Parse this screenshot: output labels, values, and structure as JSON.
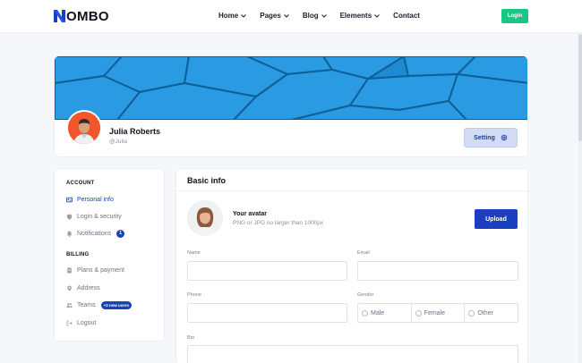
{
  "brand": {
    "name": "OMBO",
    "mark": "N-mark-logo"
  },
  "nav": {
    "items": [
      {
        "label": "Home",
        "has_dropdown": true
      },
      {
        "label": "Pages",
        "has_dropdown": true
      },
      {
        "label": "Blog",
        "has_dropdown": true
      },
      {
        "label": "Elements",
        "has_dropdown": true
      },
      {
        "label": "Contact",
        "has_dropdown": false
      }
    ],
    "login_label": "Login"
  },
  "profile": {
    "name": "Julia Roberts",
    "handle": "@Julia",
    "setting_label": "Setting",
    "setting_icon": "gear-icon"
  },
  "sidebar": {
    "account_heading": "ACCOUNT",
    "account_items": [
      {
        "label": "Personal info",
        "icon": "id-card-icon",
        "active": true
      },
      {
        "label": "Login & security",
        "icon": "shield-icon",
        "active": false
      },
      {
        "label": "Notifications",
        "icon": "bell-icon",
        "active": false,
        "badge": "1"
      }
    ],
    "billing_heading": "BILLING",
    "billing_items": [
      {
        "label": "Plans & payment",
        "icon": "document-icon"
      },
      {
        "label": "Address",
        "icon": "location-pin-icon"
      },
      {
        "label": "Teams",
        "icon": "users-icon",
        "badge": "+2 new users"
      },
      {
        "label": "Logout",
        "icon": "logout-icon"
      }
    ]
  },
  "basic_info": {
    "title": "Basic info",
    "avatar_title": "Your avatar",
    "avatar_hint": "PNG or JPG no larger than 1000px",
    "upload_label": "Upload",
    "fields": {
      "name_label": "Name",
      "name_value": "",
      "email_label": "Email",
      "email_value": "",
      "phone_label": "Phone",
      "phone_value": "",
      "gender_label": "Gender",
      "gender_options": [
        "Male",
        "Female",
        "Other"
      ],
      "bio_label": "Bio",
      "bio_value": ""
    }
  },
  "colors": {
    "primary": "#1a3fc1",
    "login_green": "#18c785",
    "cover_blue": "#1f8ed6",
    "setting_bg": "#d3dcf6"
  }
}
